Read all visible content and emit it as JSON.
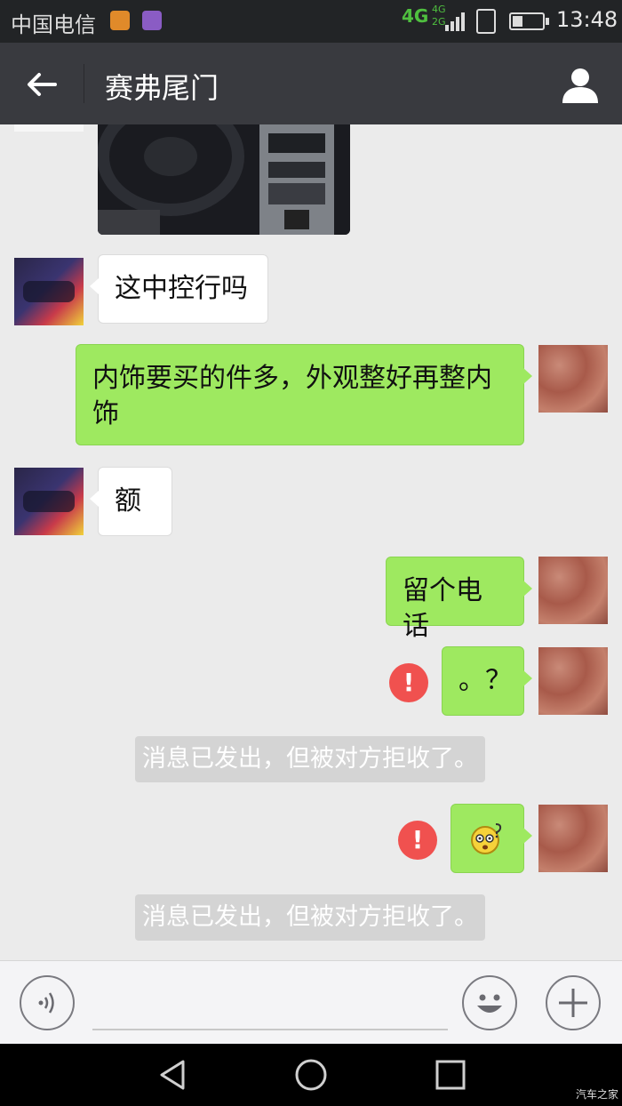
{
  "status_bar": {
    "carrier": "中国电信",
    "network_main": "4G",
    "network_secondary": [
      "4G",
      "2G"
    ],
    "time": "13:48",
    "battery_level": 0.35,
    "icons": [
      "app-notification-icon",
      "gallery-notification-icon",
      "signal-icon",
      "sim-icon",
      "battery-icon"
    ]
  },
  "header": {
    "title": "赛弗尾门",
    "back_icon": "arrow-left-icon",
    "profile_icon": "person-icon"
  },
  "messages": [
    {
      "side": "left",
      "type": "image",
      "content": "car-interior-photo"
    },
    {
      "side": "left",
      "type": "text",
      "text": "这中控行吗"
    },
    {
      "side": "right",
      "type": "text",
      "text": "内饰要买的件多，外观整好再整内饰"
    },
    {
      "side": "left",
      "type": "text",
      "text": "额"
    },
    {
      "side": "right",
      "type": "text",
      "text": "留个电话"
    },
    {
      "side": "right",
      "type": "text",
      "text": "。？",
      "error": "!"
    },
    {
      "side": "right",
      "type": "emoji",
      "content": "confused-face-emoji",
      "error": "!"
    }
  ],
  "system_notes": [
    "消息已发出，但被对方拒收了。",
    "消息已发出，但被对方拒收了。"
  ],
  "input_bar": {
    "placeholder": "",
    "icons": [
      "voice-icon",
      "emoji-icon",
      "plus-icon"
    ]
  },
  "system_nav": {
    "icons": [
      "back-triangle-icon",
      "home-circle-icon",
      "recents-square-icon"
    ]
  },
  "watermark": "汽车之家",
  "colors": {
    "status_bar_bg": "#222426",
    "nav_bg": "#393a3f",
    "chat_bg": "#ebebeb",
    "green_bubble": "#9ee960",
    "error_red": "#f0514f"
  }
}
